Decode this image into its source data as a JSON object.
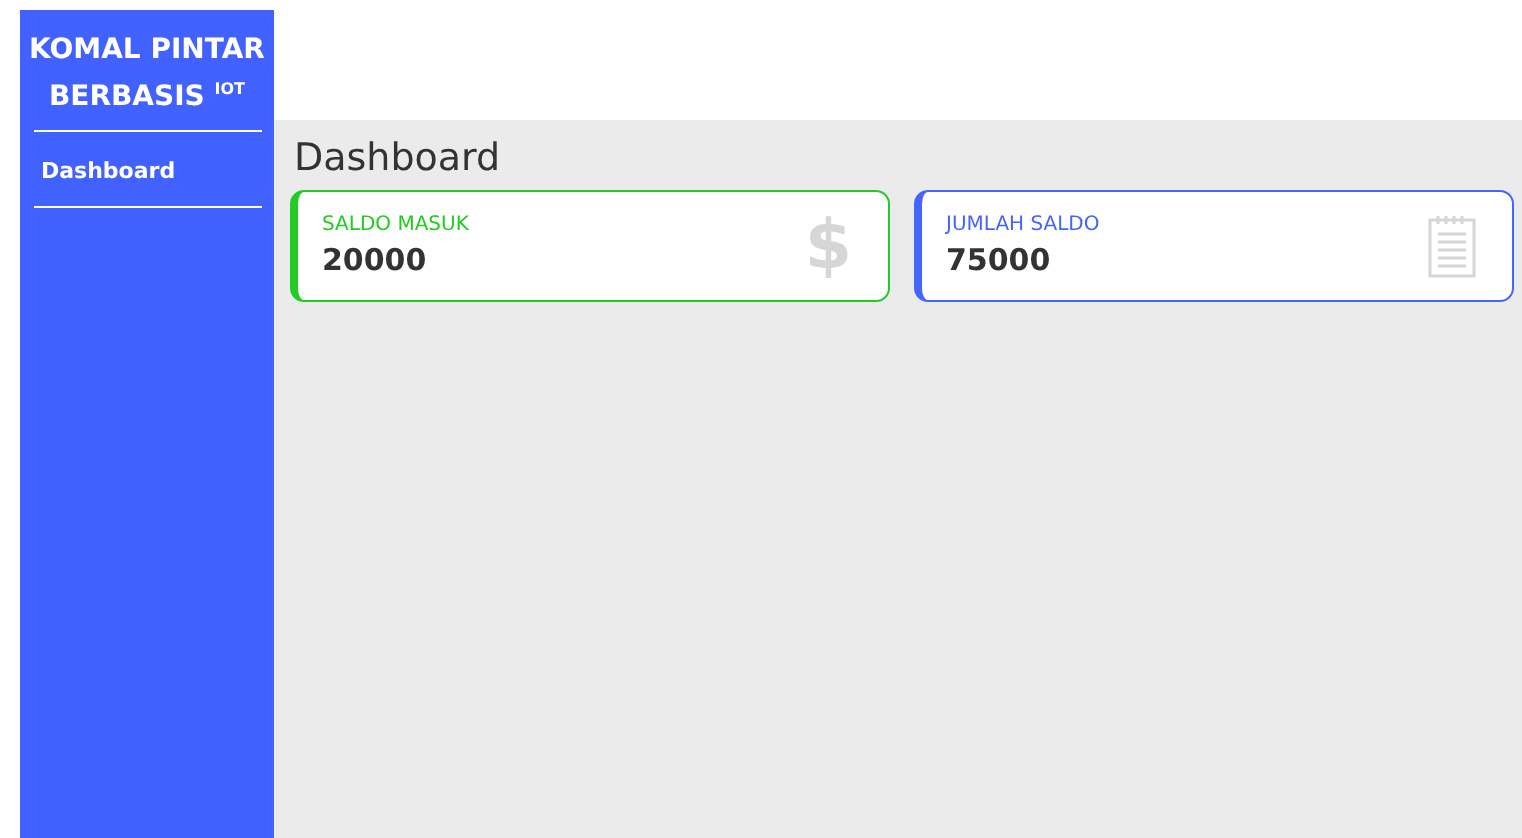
{
  "sidebar": {
    "brand": "KOMAL PINTAR BERBASIS $^{IOT}$",
    "items": [
      {
        "label": "Dashboard",
        "selected": true
      }
    ]
  },
  "page": {
    "title": "Dashboard"
  },
  "cards": [
    {
      "label": "SALDO MASUK",
      "value": "20000",
      "color": "#22cc22",
      "icon": {
        "kind": "dollar",
        "text": "$"
      }
    },
    {
      "label": "JUMLAH SALDO",
      "value": "75000",
      "color": "#4466ff",
      "icon": {
        "kind": "notepad"
      }
    }
  ]
}
